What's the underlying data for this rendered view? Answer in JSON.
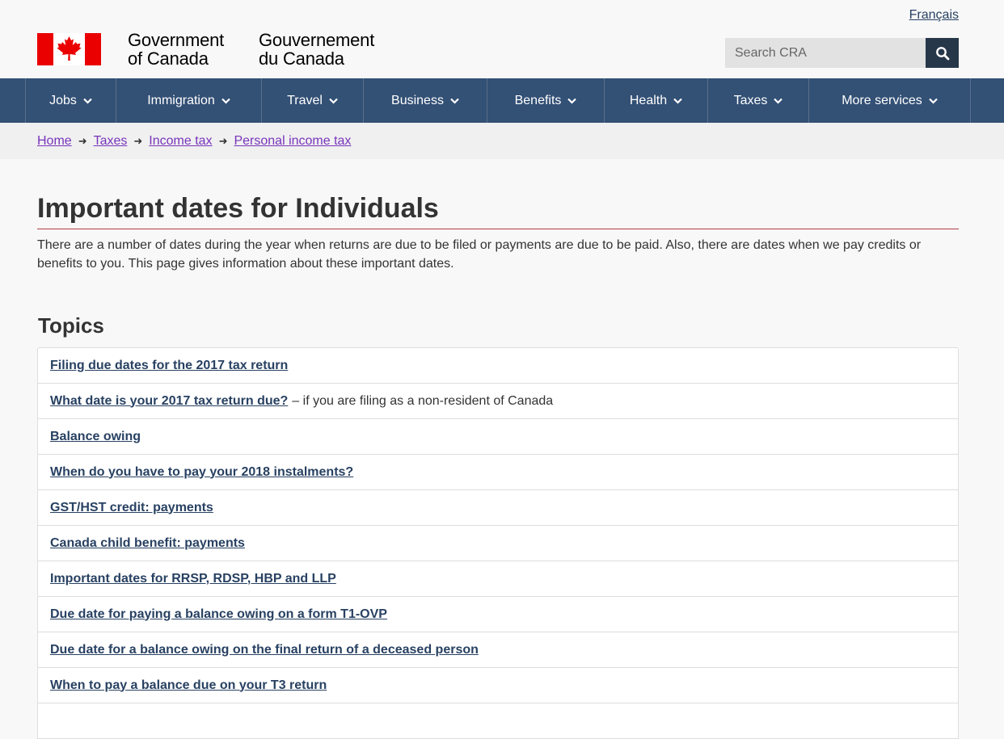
{
  "header": {
    "lang_link": "Français",
    "signature_en_line1": "Government",
    "signature_en_line2": "of Canada",
    "signature_fr_line1": "Gouvernement",
    "signature_fr_line2": "du Canada",
    "search_placeholder": "Search CRA",
    "search_icon": "search-icon",
    "flag_color": "#ea0000"
  },
  "nav": {
    "items": [
      {
        "label": "Jobs"
      },
      {
        "label": "Immigration"
      },
      {
        "label": "Travel"
      },
      {
        "label": "Business"
      },
      {
        "label": "Benefits"
      },
      {
        "label": "Health"
      },
      {
        "label": "Taxes"
      },
      {
        "label": "More services"
      }
    ],
    "background": "#335075"
  },
  "breadcrumb": {
    "items": [
      {
        "label": "Home"
      },
      {
        "label": "Taxes"
      },
      {
        "label": "Income tax"
      },
      {
        "label": "Personal income tax"
      }
    ]
  },
  "main": {
    "title": "Important dates for Individuals",
    "intro": "There are a number of dates during the year when returns are due to be filed or payments are due to be paid. Also, there are dates when we pay credits or benefits to you. This page gives information about these important dates.",
    "topics_heading": "Topics",
    "topics": [
      {
        "label": "Filing due dates for the 2017 tax return",
        "suffix": ""
      },
      {
        "label": "What date is your 2017 tax return due?",
        "suffix": "– if you are filing as a non-resident of Canada"
      },
      {
        "label": "Balance owing",
        "suffix": ""
      },
      {
        "label": "When do you have to pay your 2018 instalments?",
        "suffix": ""
      },
      {
        "label": "GST/HST credit: payments",
        "suffix": ""
      },
      {
        "label": "Canada child benefit: payments",
        "suffix": ""
      },
      {
        "label": "Important dates for RRSP, RDSP, HBP and LLP",
        "suffix": ""
      },
      {
        "label": "Due date for paying a balance owing on a form T1-OVP",
        "suffix": ""
      },
      {
        "label": "Due date for a balance owing on the final return of a deceased person",
        "suffix": ""
      },
      {
        "label": "When to pay a balance due on your T3 return",
        "suffix": ""
      }
    ]
  }
}
